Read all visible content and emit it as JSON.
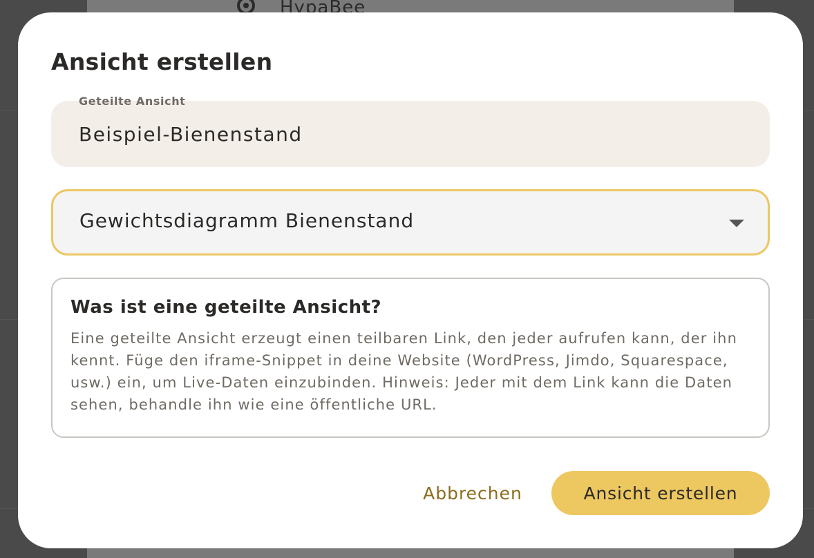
{
  "background": {
    "list_item_label": "HypaBee",
    "list_item_icon": "location-pin-icon"
  },
  "dialog": {
    "title": "Ansicht erstellen",
    "name_field": {
      "label": "Geteilte Ansicht",
      "value": "Beispiel-Bienenstand"
    },
    "dashboard_select": {
      "selected": "Gewichtsdiagramm Bienenstand",
      "icon": "chevron-down-icon"
    },
    "info": {
      "title": "Was ist eine geteilte Ansicht?",
      "text": "Eine geteilte Ansicht erzeugt einen teilbaren Link, den jeder aufrufen kann, der ihn kennt. Füge den iframe-Snippet in deine Website (WordPress, Jimdo, Squarespace, usw.) ein, um Live-Daten einzubinden. Hinweis: Jeder mit dem Link kann die Daten sehen, behandle ihn wie eine öffentliche URL."
    },
    "actions": {
      "cancel_label": "Abbrechen",
      "submit_label": "Ansicht erstellen"
    }
  },
  "colors": {
    "accent": "#edc760",
    "accent_text": "#8c6d1f",
    "focus_border": "#ecc763",
    "field_bg": "#f3eee8"
  }
}
